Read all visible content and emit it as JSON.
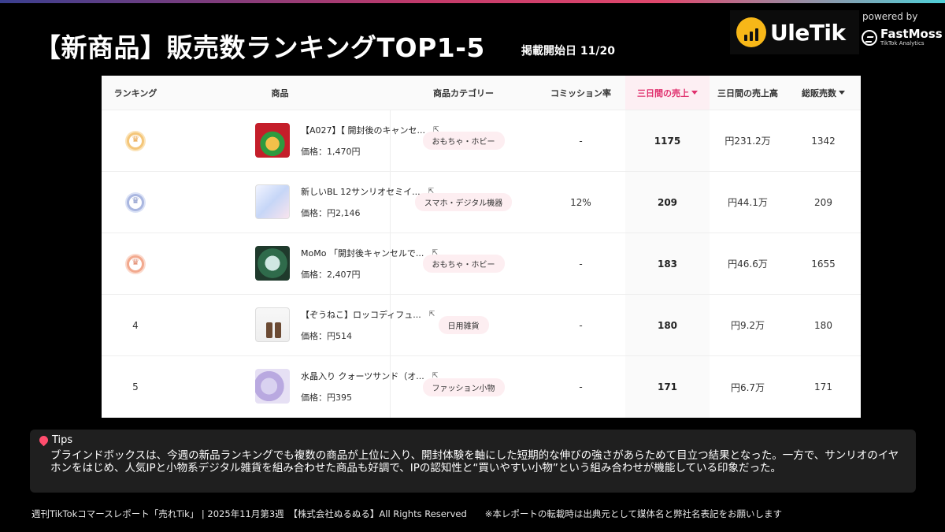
{
  "header": {
    "title": "【新商品】販売数ランキングTOP1-5",
    "published_label": "掲載開始日 11/20",
    "logo_text": "UleTik",
    "powered_by": "powered by",
    "partner_name": "FastMoss",
    "partner_sub": "TikTok Analytics"
  },
  "table": {
    "columns": {
      "rank": "ランキング",
      "product": "商品",
      "category": "商品カテゴリー",
      "commission": "コミッション率",
      "sales3": "三日間の売上",
      "revenue3": "三日間の売上高",
      "total": "総販売数"
    },
    "rows": [
      {
        "rank": "",
        "medal": "gold",
        "name": "【A027】【 開封後のキャンセ...",
        "price": "価格：1,470円",
        "category": "おもちゃ・ホビー",
        "commission": "-",
        "sales3": "1175",
        "revenue3": "円231.2万",
        "total": "1342"
      },
      {
        "rank": "",
        "medal": "silver",
        "name": "新しいBL 12サンリオセミイ...",
        "price": "価格：円2,146",
        "category": "スマホ・デジタル機器",
        "commission": "12%",
        "sales3": "209",
        "revenue3": "円44.1万",
        "total": "209"
      },
      {
        "rank": "",
        "medal": "bronze",
        "name": "MoMo 「開封後キャンセルで...",
        "price": "価格：2,407円",
        "category": "おもちゃ・ホビー",
        "commission": "-",
        "sales3": "183",
        "revenue3": "円46.6万",
        "total": "1655"
      },
      {
        "rank": "4",
        "medal": "",
        "name": "【ぞうねこ】ロッコディフュ...",
        "price": "価格：円514",
        "category": "日用雑貨",
        "commission": "-",
        "sales3": "180",
        "revenue3": "円9.2万",
        "total": "180"
      },
      {
        "rank": "5",
        "medal": "",
        "name": "水晶入り クォーツサンド（オ...",
        "price": "価格：円395",
        "category": "ファッション小物",
        "commission": "-",
        "sales3": "171",
        "revenue3": "円6.7万",
        "total": "171"
      }
    ],
    "external_link_glyph": "⇱"
  },
  "tips": {
    "heading": "Tips",
    "body": "ブラインドボックスは、今週の新品ランキングでも複数の商品が上位に入り、開封体験を軸にした短期的な伸びの強さがあらためて目立つ結果となった。一方で、サンリオのイヤホンをはじめ、人気IPと小物系デジタル雑貨を組み合わせた商品も好調で、IPの認知性と“買いやすい小物”という組み合わせが機能している印象だった。"
  },
  "footer": "週刊TikTokコマースレポート「売れTik」 | 2025年11月第3週　【株式会社ぬるぬる】All Rights Reserved　　※本レポートの転載時は出典元として媒体名と弊社名表記をお願いします",
  "colors": {
    "accent": "#e0306d",
    "gold": "#f4c67a",
    "silver": "#aab7e0",
    "bronze": "#f2a98e"
  }
}
